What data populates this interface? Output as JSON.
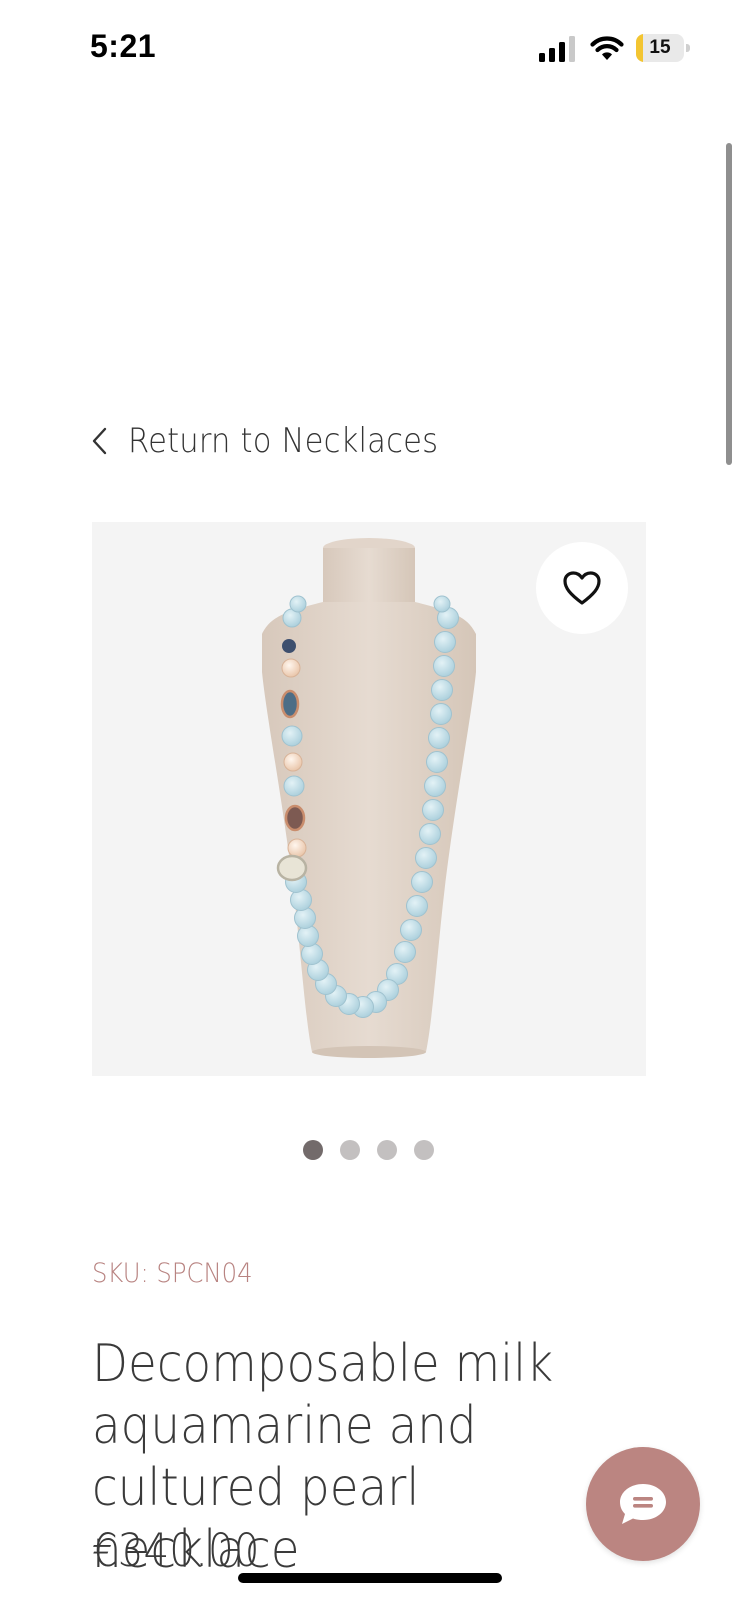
{
  "status_bar": {
    "time": "5:21",
    "battery_level": "15",
    "battery_fraction": 0.15,
    "icons": [
      "signal-icon",
      "wifi-icon",
      "battery-icon"
    ]
  },
  "navigation": {
    "back_label": "Return to Necklaces",
    "back_icon": "chevron-left-icon"
  },
  "product": {
    "image_alt": "Decomposable milk aquamarine and cultured pearl necklace on a beige bust",
    "wishlist_icon": "heart-icon",
    "carousel": {
      "total": 4,
      "active_index": 0
    },
    "sku": "SKU: SPCN04",
    "title": "Decomposable milk aquamarine and cultured pearl necklace",
    "price": "€340.00"
  },
  "chat": {
    "icon": "chat-icon"
  },
  "colors": {
    "accent": "#bb8581",
    "sku_text": "#b88381",
    "dot_active": "#736b6b",
    "dot_inactive": "#c3c0c0",
    "image_background": "#f4f4f4"
  }
}
